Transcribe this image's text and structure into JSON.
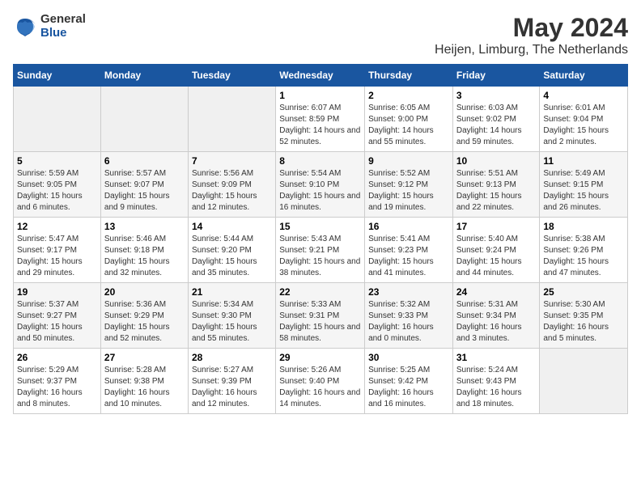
{
  "header": {
    "logo_general": "General",
    "logo_blue": "Blue",
    "title": "May 2024",
    "subtitle": "Heijen, Limburg, The Netherlands"
  },
  "days_of_week": [
    "Sunday",
    "Monday",
    "Tuesday",
    "Wednesday",
    "Thursday",
    "Friday",
    "Saturday"
  ],
  "weeks": [
    [
      {
        "day": "",
        "info": ""
      },
      {
        "day": "",
        "info": ""
      },
      {
        "day": "",
        "info": ""
      },
      {
        "day": "1",
        "info": "Sunrise: 6:07 AM\nSunset: 8:59 PM\nDaylight: 14 hours and 52 minutes."
      },
      {
        "day": "2",
        "info": "Sunrise: 6:05 AM\nSunset: 9:00 PM\nDaylight: 14 hours and 55 minutes."
      },
      {
        "day": "3",
        "info": "Sunrise: 6:03 AM\nSunset: 9:02 PM\nDaylight: 14 hours and 59 minutes."
      },
      {
        "day": "4",
        "info": "Sunrise: 6:01 AM\nSunset: 9:04 PM\nDaylight: 15 hours and 2 minutes."
      }
    ],
    [
      {
        "day": "5",
        "info": "Sunrise: 5:59 AM\nSunset: 9:05 PM\nDaylight: 15 hours and 6 minutes."
      },
      {
        "day": "6",
        "info": "Sunrise: 5:57 AM\nSunset: 9:07 PM\nDaylight: 15 hours and 9 minutes."
      },
      {
        "day": "7",
        "info": "Sunrise: 5:56 AM\nSunset: 9:09 PM\nDaylight: 15 hours and 12 minutes."
      },
      {
        "day": "8",
        "info": "Sunrise: 5:54 AM\nSunset: 9:10 PM\nDaylight: 15 hours and 16 minutes."
      },
      {
        "day": "9",
        "info": "Sunrise: 5:52 AM\nSunset: 9:12 PM\nDaylight: 15 hours and 19 minutes."
      },
      {
        "day": "10",
        "info": "Sunrise: 5:51 AM\nSunset: 9:13 PM\nDaylight: 15 hours and 22 minutes."
      },
      {
        "day": "11",
        "info": "Sunrise: 5:49 AM\nSunset: 9:15 PM\nDaylight: 15 hours and 26 minutes."
      }
    ],
    [
      {
        "day": "12",
        "info": "Sunrise: 5:47 AM\nSunset: 9:17 PM\nDaylight: 15 hours and 29 minutes."
      },
      {
        "day": "13",
        "info": "Sunrise: 5:46 AM\nSunset: 9:18 PM\nDaylight: 15 hours and 32 minutes."
      },
      {
        "day": "14",
        "info": "Sunrise: 5:44 AM\nSunset: 9:20 PM\nDaylight: 15 hours and 35 minutes."
      },
      {
        "day": "15",
        "info": "Sunrise: 5:43 AM\nSunset: 9:21 PM\nDaylight: 15 hours and 38 minutes."
      },
      {
        "day": "16",
        "info": "Sunrise: 5:41 AM\nSunset: 9:23 PM\nDaylight: 15 hours and 41 minutes."
      },
      {
        "day": "17",
        "info": "Sunrise: 5:40 AM\nSunset: 9:24 PM\nDaylight: 15 hours and 44 minutes."
      },
      {
        "day": "18",
        "info": "Sunrise: 5:38 AM\nSunset: 9:26 PM\nDaylight: 15 hours and 47 minutes."
      }
    ],
    [
      {
        "day": "19",
        "info": "Sunrise: 5:37 AM\nSunset: 9:27 PM\nDaylight: 15 hours and 50 minutes."
      },
      {
        "day": "20",
        "info": "Sunrise: 5:36 AM\nSunset: 9:29 PM\nDaylight: 15 hours and 52 minutes."
      },
      {
        "day": "21",
        "info": "Sunrise: 5:34 AM\nSunset: 9:30 PM\nDaylight: 15 hours and 55 minutes."
      },
      {
        "day": "22",
        "info": "Sunrise: 5:33 AM\nSunset: 9:31 PM\nDaylight: 15 hours and 58 minutes."
      },
      {
        "day": "23",
        "info": "Sunrise: 5:32 AM\nSunset: 9:33 PM\nDaylight: 16 hours and 0 minutes."
      },
      {
        "day": "24",
        "info": "Sunrise: 5:31 AM\nSunset: 9:34 PM\nDaylight: 16 hours and 3 minutes."
      },
      {
        "day": "25",
        "info": "Sunrise: 5:30 AM\nSunset: 9:35 PM\nDaylight: 16 hours and 5 minutes."
      }
    ],
    [
      {
        "day": "26",
        "info": "Sunrise: 5:29 AM\nSunset: 9:37 PM\nDaylight: 16 hours and 8 minutes."
      },
      {
        "day": "27",
        "info": "Sunrise: 5:28 AM\nSunset: 9:38 PM\nDaylight: 16 hours and 10 minutes."
      },
      {
        "day": "28",
        "info": "Sunrise: 5:27 AM\nSunset: 9:39 PM\nDaylight: 16 hours and 12 minutes."
      },
      {
        "day": "29",
        "info": "Sunrise: 5:26 AM\nSunset: 9:40 PM\nDaylight: 16 hours and 14 minutes."
      },
      {
        "day": "30",
        "info": "Sunrise: 5:25 AM\nSunset: 9:42 PM\nDaylight: 16 hours and 16 minutes."
      },
      {
        "day": "31",
        "info": "Sunrise: 5:24 AM\nSunset: 9:43 PM\nDaylight: 16 hours and 18 minutes."
      },
      {
        "day": "",
        "info": ""
      }
    ]
  ]
}
